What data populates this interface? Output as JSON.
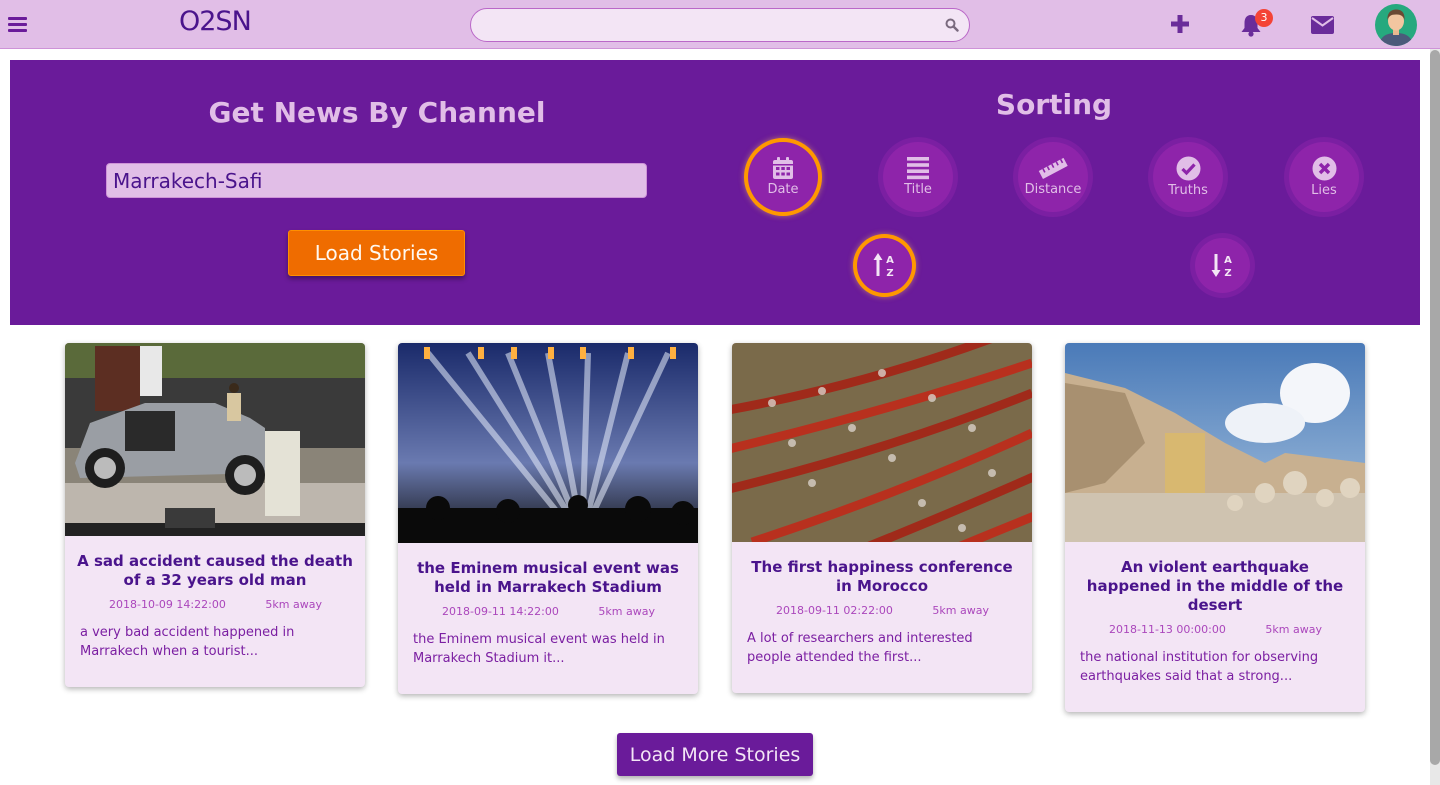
{
  "navbar": {
    "logo": "O2SN",
    "search": {
      "value": "",
      "placeholder": ""
    },
    "icons": [
      "menu-icon",
      "add-icon",
      "notification-bell-icon",
      "mail-icon",
      "user-avatar"
    ],
    "notification_count": "3"
  },
  "channel": {
    "title": "Get News By Channel",
    "input_value": "Marrakech-Safi",
    "load_button": "Load Stories"
  },
  "sorting": {
    "title": "Sorting",
    "options": [
      {
        "label": "Date",
        "icon": "calendar-icon",
        "active": true
      },
      {
        "label": "Title",
        "icon": "list-icon",
        "active": false
      },
      {
        "label": "Distance",
        "icon": "ruler-icon",
        "active": false
      },
      {
        "label": "Truths",
        "icon": "check-circle-icon",
        "active": false
      },
      {
        "label": "Lies",
        "icon": "times-circle-icon",
        "active": false
      }
    ],
    "order": [
      {
        "name": "ascending",
        "icon": "sort-alpha-up-icon",
        "active": true
      },
      {
        "name": "descending",
        "icon": "sort-alpha-down-icon",
        "active": false
      }
    ]
  },
  "stories": [
    {
      "title": "A sad accident caused the death of a 32 years old man",
      "date": "2018-10-09 14:22:00",
      "distance": "5km away",
      "excerpt": "a very bad accident happened in Marrakech when a tourist...",
      "image": "car-accident-photo"
    },
    {
      "title": "the Eminem musical event was held in Marrakech Stadium",
      "date": "2018-09-11 14:22:00",
      "distance": "5km away",
      "excerpt": "the Eminem musical event was held in Marrakech Stadium it...",
      "image": "concert-photo"
    },
    {
      "title": "The first happiness conference in Morocco",
      "date": "2018-09-11 02:22:00",
      "distance": "5km away",
      "excerpt": "A lot of researchers and interested people attended the first...",
      "image": "conference-hall-photo"
    },
    {
      "title": "An violent earthquake happened in the middle of the desert",
      "date": "2018-11-13 00:00:00",
      "distance": "5km away",
      "excerpt": "the national institution for observing earthquakes said that a strong...",
      "image": "earthquake-ruins-photo"
    }
  ],
  "load_more": "Load More Stories",
  "colors": {
    "navbar": "#e1bee7",
    "primary": "#6a1b9a",
    "accent": "#ef6c00",
    "active_ring": "#ff9800",
    "card_bg": "#f3e5f5"
  }
}
